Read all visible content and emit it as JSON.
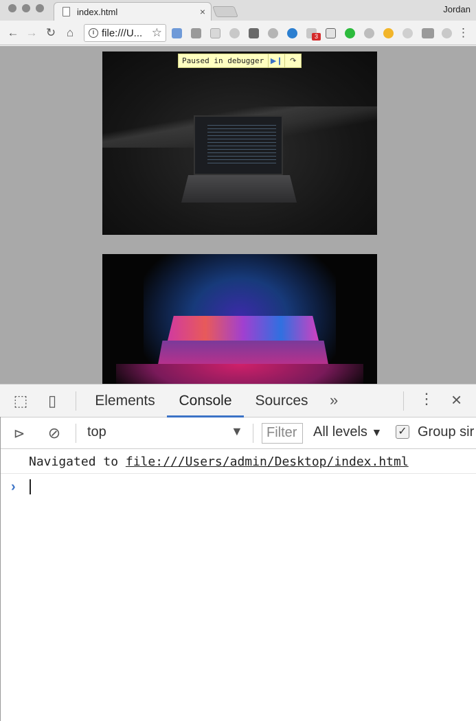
{
  "browser": {
    "tab_title": "index.html",
    "tab_close": "×",
    "profile_name": "Jordan",
    "omnibox_url": "file:///U...",
    "extension_badge": "3"
  },
  "page": {
    "debugger_banner": "Paused in debugger"
  },
  "devtools": {
    "tabs": [
      "Elements",
      "Console",
      "Sources"
    ],
    "active_tab": "Console",
    "more_tabs": "»",
    "context": "top",
    "filter_placeholder": "Filter",
    "levels": "All levels",
    "group_label": "Group sir",
    "log": {
      "prefix": "Navigated to",
      "link": "file:///Users/admin/Desktop/index.html"
    },
    "prompt": "›"
  },
  "colors": {
    "accent": "#3b72c6",
    "page_bg": "#a9a9a9",
    "banner_bg": "#ffffc0"
  }
}
